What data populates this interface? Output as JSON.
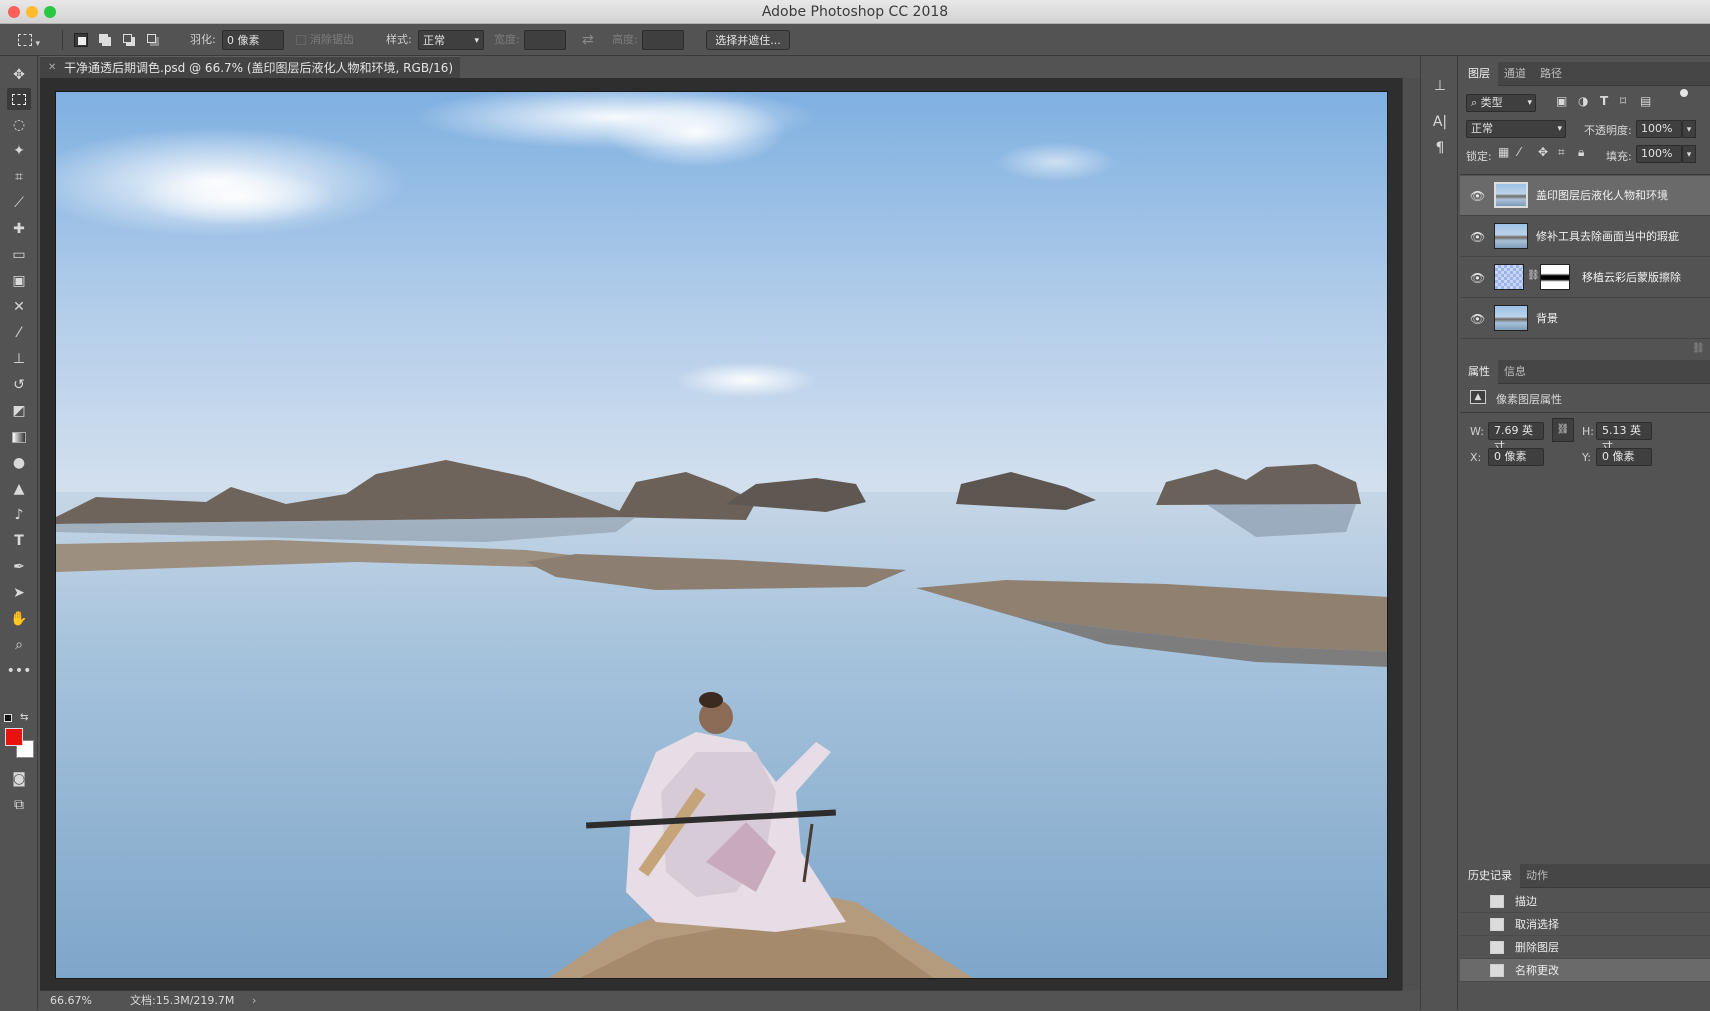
{
  "window": {
    "title": "Adobe Photoshop CC 2018"
  },
  "options_bar": {
    "feather_label": "羽化:",
    "feather_value": "0 像素",
    "antialias_label": "消除锯齿",
    "style_label": "样式:",
    "style_value": "正常",
    "width_label": "宽度:",
    "height_label": "高度:",
    "select_mask_button": "选择并遮住..."
  },
  "document": {
    "tab_title": "干净通透后期调色.psd @ 66.7% (盖印图层后液化人物和环境, RGB/16) *",
    "zoom": "66.67%",
    "doc_size": "文档:15.3M/219.7M"
  },
  "layers_panel": {
    "tabs": [
      "图层",
      "通道",
      "路径"
    ],
    "filter_label": "类型",
    "blend_mode": "正常",
    "opacity_label": "不透明度:",
    "opacity_value": "100%",
    "lock_label": "锁定:",
    "fill_label": "填充:",
    "fill_value": "100%",
    "layers": [
      {
        "name": "盖印图层后液化人物和环境",
        "selected": true
      },
      {
        "name": "修补工具去除画面当中的瑕疵",
        "selected": false
      },
      {
        "name": "移植云彩后蒙版擦除",
        "selected": false
      },
      {
        "name": "背景",
        "selected": false
      }
    ]
  },
  "properties_panel": {
    "tabs": [
      "属性",
      "信息"
    ],
    "header": "像素图层属性",
    "w_label": "W:",
    "w_value": "7.69 英寸",
    "h_label": "H:",
    "h_value": "5.13 英寸",
    "x_label": "X:",
    "x_value": "0 像素",
    "y_label": "Y:",
    "y_value": "0 像素"
  },
  "history_panel": {
    "tabs": [
      "历史记录",
      "动作"
    ],
    "items": [
      {
        "label": "描边",
        "selected": false
      },
      {
        "label": "取消选择",
        "selected": false
      },
      {
        "label": "删除图层",
        "selected": false
      },
      {
        "label": "名称更改",
        "selected": true
      }
    ]
  },
  "colors": {
    "foreground": "#e8130f",
    "background": "#ffffff"
  }
}
